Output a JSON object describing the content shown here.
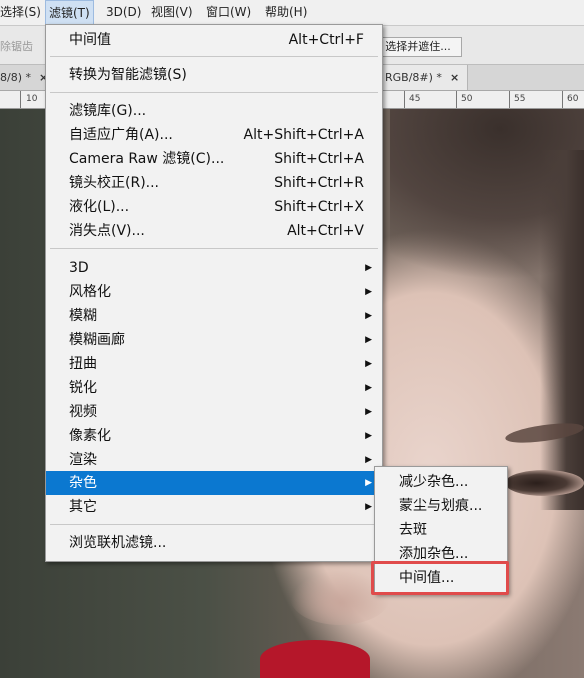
{
  "menubar": {
    "items": [
      {
        "label": "选择(S)"
      },
      {
        "label": "滤镜(T)"
      },
      {
        "label": "3D(D)"
      },
      {
        "label": "视图(V)"
      },
      {
        "label": "窗口(W)"
      },
      {
        "label": "帮助(H)"
      }
    ]
  },
  "options_bar": {
    "faded_label": "除锯齿",
    "select_mask_button": "选择并遮住..."
  },
  "tabs": {
    "left_tab": "8/8) *",
    "right_tab": "RGB/8#) *",
    "close_glyph": "×"
  },
  "ruler": {
    "ticks": [
      "10",
      "45",
      "50",
      "55",
      "60"
    ]
  },
  "filter_menu": {
    "last_filter": {
      "label": "中间值",
      "shortcut": "Alt+Ctrl+F"
    },
    "convert_smart": "转换为智能滤镜(S)",
    "group2": [
      {
        "label": "滤镜库(G)...",
        "shortcut": ""
      },
      {
        "label": "自适应广角(A)...",
        "shortcut": "Alt+Shift+Ctrl+A"
      },
      {
        "label": "Camera Raw 滤镜(C)...",
        "shortcut": "Shift+Ctrl+A"
      },
      {
        "label": "镜头校正(R)...",
        "shortcut": "Shift+Ctrl+R"
      },
      {
        "label": "液化(L)...",
        "shortcut": "Shift+Ctrl+X"
      },
      {
        "label": "消失点(V)...",
        "shortcut": "Alt+Ctrl+V"
      }
    ],
    "submenus": [
      {
        "label": "3D"
      },
      {
        "label": "风格化"
      },
      {
        "label": "模糊"
      },
      {
        "label": "模糊画廊"
      },
      {
        "label": "扭曲"
      },
      {
        "label": "锐化"
      },
      {
        "label": "视频"
      },
      {
        "label": "像素化"
      },
      {
        "label": "渲染"
      },
      {
        "label": "杂色"
      },
      {
        "label": "其它"
      }
    ],
    "highlighted": "杂色",
    "browse_online": "浏览联机滤镜..."
  },
  "noise_submenu": {
    "items": [
      {
        "label": "减少杂色..."
      },
      {
        "label": "蒙尘与划痕..."
      },
      {
        "label": "去斑"
      },
      {
        "label": "添加杂色..."
      },
      {
        "label": "中间值..."
      }
    ],
    "emphasized": "中间值...",
    "emphasis_color": "#e04b4b"
  },
  "colors": {
    "highlight": "#0b78d0",
    "menu_bg": "#f2f2f2"
  }
}
